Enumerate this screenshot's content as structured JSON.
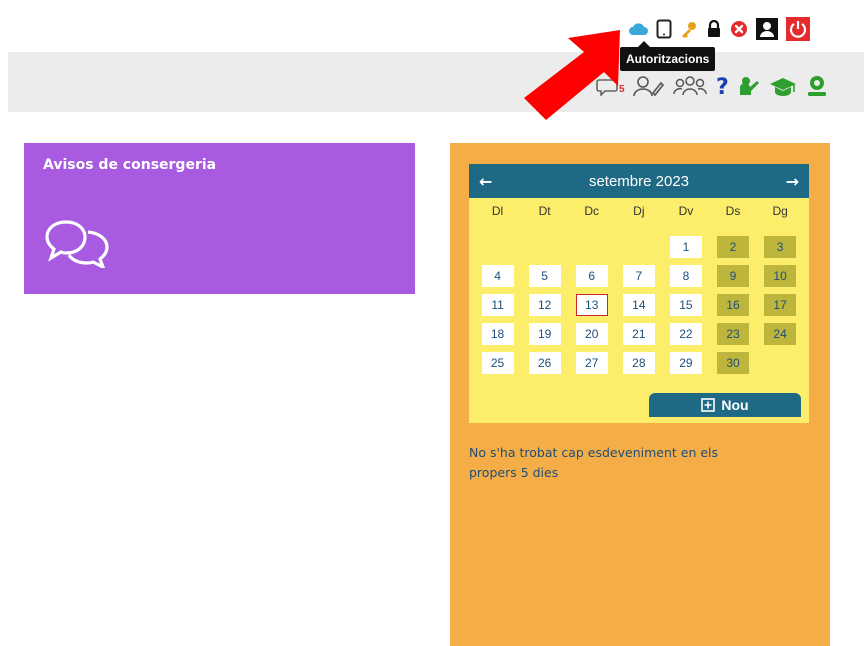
{
  "tooltip": {
    "text": "Autoritzacions"
  },
  "top_icons": [
    "cloud-icon",
    "tablet-icon",
    "key-icon",
    "lock-icon",
    "close-circle-icon",
    "user-profile-icon",
    "power-icon"
  ],
  "second_icons": {
    "messages_badge": "5",
    "items": [
      "chat-icon",
      "user-edit-icon",
      "group-icon",
      "help-icon",
      "teacher-icon",
      "graduation-cap-icon",
      "user-settings-icon"
    ]
  },
  "purple_card": {
    "title": "Avisos de consergeria",
    "icon": "chat-bubbles-icon"
  },
  "calendar": {
    "month_label": "setembre 2023",
    "prev_symbol": "←",
    "next_symbol": "→",
    "day_labels": [
      "Dl",
      "Dt",
      "Dc",
      "Dj",
      "Dv",
      "Ds",
      "Dg"
    ],
    "weeks": [
      [
        "",
        "",
        "",
        "",
        "1",
        "2",
        "3"
      ],
      [
        "4",
        "5",
        "6",
        "7",
        "8",
        "9",
        "10"
      ],
      [
        "11",
        "12",
        "13",
        "14",
        "15",
        "16",
        "17"
      ],
      [
        "18",
        "19",
        "20",
        "21",
        "22",
        "23",
        "24"
      ],
      [
        "25",
        "26",
        "27",
        "28",
        "29",
        "30",
        ""
      ]
    ],
    "today": "13",
    "new_button_label": "Nou"
  },
  "events": {
    "empty_text": "No s'ha trobat cap esdeveniment en els propers 5 dies"
  },
  "colors": {
    "purple": "#a85be0",
    "orange": "#f5ae47",
    "calendar_yellow": "#fcee6a",
    "calendar_header": "#1e6a85",
    "weekend": "#bdb53c",
    "arrow_red": "#ff0000"
  }
}
